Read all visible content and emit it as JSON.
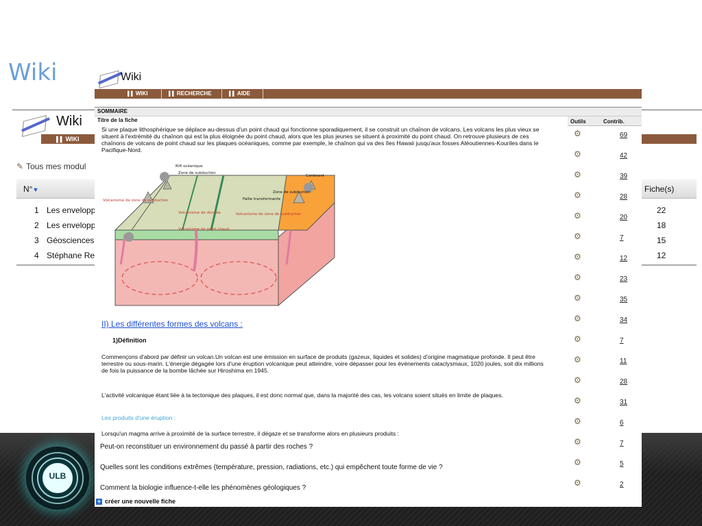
{
  "slide": {
    "title": "Wiki",
    "logo_text": "ULB"
  },
  "bg_wiki": {
    "logo_text": "Wiki",
    "tab": "WIKI",
    "modules_label": "Tous mes modul",
    "table": {
      "col_num": "N°",
      "col_fiches": "Fiche(s)",
      "rows": [
        {
          "num": "1",
          "title": "Les envelopp",
          "fiches": "22"
        },
        {
          "num": "2",
          "title": "Les envelopp",
          "fiches": "18"
        },
        {
          "num": "3",
          "title": "Géosciences",
          "fiches": "15"
        },
        {
          "num": "4",
          "title": "Stéphane Re",
          "fiches": "12"
        }
      ]
    }
  },
  "fg_wiki": {
    "logo_text": "Wiki",
    "nav": [
      "WIKI",
      "RECHERCHE",
      "AIDE"
    ],
    "sommaire": "SOMMAIRE",
    "titre_fiche": "Titre de la fiche",
    "col_outils": "Outils",
    "col_contrib": "Contrib.",
    "contribs": [
      "69",
      "42",
      "39",
      "28",
      "20",
      "7",
      "12",
      "23",
      "35",
      "34",
      "7",
      "11",
      "28",
      "31",
      "6",
      "7",
      "5",
      "2"
    ],
    "visible_rows": [
      "Peut-on reconstituer un environnement du passé à partir des roches ?",
      "Quelles sont les conditions extrêmes (température, pression, radiations, etc.) qui empêchent toute forme de vie ?",
      "Comment la biologie influence-t-elle les phénomènes géologiques ?"
    ],
    "create_label": "créer une nouvelle fiche"
  },
  "article": {
    "p1": "Si une plaque lithosphérique se déplace au-dessus d'un point chaud qui fonctionne sporadiquement, il se construit un chaînon de volcans. Les volcans les plus vieux se situent à l'extrémité du chaînon qui est la plus éloignée du point chaud, alors que les plus jeunes se situent à proximité du point chaud. On retrouve plusieurs de ces chaînons de volcans de point chaud sur les plaques océaniques, comme par exemple, le chaînon qui va des îles Hawaii jusqu'aux fosses Aléoutiennes-Kouriles dans le Pacifique-Nord.",
    "diagram_labels": {
      "rift": "Rift océanique",
      "zone_sub_left": "Zone de subduction",
      "continent": "Continent",
      "zone_sub_right": "Zone de subduction",
      "faille": "Faille transformante",
      "volc_zone_sub": "Volcanisme de zone de subduction",
      "volc_dorsale": "Volcanisme de dorsale",
      "volc_zone_sub2": "Volcanisme de zone de subduction",
      "volc_point_chaud": "Volcanisme de point chaud"
    },
    "h2": "II) Les différentes formes des volcans :",
    "h3": "1)Définition",
    "p2": "Commençons d'abord par définir un volcan.Un volcan est une émission en surface de produits (gazeux, liquides et solides) d'origine magmatique profonde. Il peut être terrestre ou sous-marin. L'énergie dégagée lors d'une éruption volcanique peut atteindre, voire dépasser pour les événements cataclysmaux, 1020 joules, soit dix millions de fois la puissance de la bombe lâchée sur Hiroshima en 1945.",
    "p3": "L'activité volcanique étant liée à la tectonique des plaques, il est donc normal que, dans la majorité des cas, les volcans soient situés en limite de plaques.",
    "h4": "Les produits d'une éruption :",
    "p4": "Lorsqu'un magma arrive à proximité de la surface terrestre, il dégaze et se transforme alors en plusieurs produits :"
  },
  "colors": {
    "nav_brown": "#8b5a3c",
    "slide_title": "#6aa0d8",
    "link_blue": "#1f4fd0",
    "subtitle_cyan": "#3aa8d8"
  }
}
